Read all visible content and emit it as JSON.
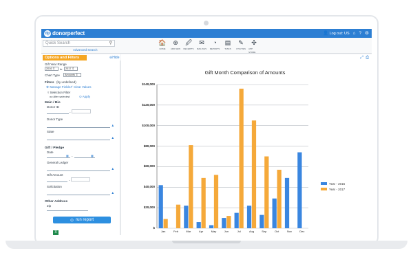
{
  "app": {
    "brand": "donorperfect",
    "logout_label": "Log out: US"
  },
  "search": {
    "placeholder": "Quick Search",
    "advanced_label": "Advanced Search"
  },
  "nav": [
    {
      "label": "HOME",
      "icon": "home-icon",
      "glyph": "🏠"
    },
    {
      "label": "ADD NEW",
      "icon": "add-icon",
      "glyph": "⊕"
    },
    {
      "label": "RECEIPTS",
      "icon": "receipt-icon",
      "glyph": "🖉"
    },
    {
      "label": "MAILINGS",
      "icon": "envelope-icon",
      "glyph": "✉"
    },
    {
      "label": "REPORTS",
      "icon": "pie-chart-icon",
      "glyph": "◔"
    },
    {
      "label": "TASKS",
      "icon": "clipboard-icon",
      "glyph": "▤"
    },
    {
      "label": "UTILITIES",
      "icon": "wrench-icon",
      "glyph": "✎"
    },
    {
      "label": "APP STORE",
      "icon": "puzzle-icon",
      "glyph": "✣"
    }
  ],
  "sidebar": {
    "title": "Options and Filters",
    "hide_label": "Hide",
    "gift_year_range_label": "Gift Year Range",
    "year_from": "2016",
    "to_label": "to",
    "year_to": "2017",
    "chart_type_label": "Chart Type",
    "chart_type_value": "Amounts",
    "filters_label": "Filters",
    "filters_value": "(by undefined)",
    "manage_fields": "Manage Fields",
    "clear_values": "Clear Values",
    "selection_filter_label": "Selection Filter",
    "selection_filter_value": "no filter selected",
    "apply_label": "Apply",
    "main_bio": "Main / Bio",
    "donor_id": "Donor ID",
    "donor_type": "Donor Type",
    "state": "State",
    "gift_pledge": "Gift / Pledge",
    "date": "Date",
    "general_ledger": "General Ledger",
    "gift_amount": "Gift Amount",
    "solicitation": "Solicitation",
    "other_address": "Other Address",
    "zip": "Zip",
    "run_report": "run report",
    "dash": "-"
  },
  "chart_data": {
    "type": "bar",
    "title": "Gift Month Comparison of Amounts",
    "categories": [
      "Jan",
      "Feb",
      "Mar",
      "Apr",
      "May",
      "Jun",
      "Jul",
      "Aug",
      "Sep",
      "Oct",
      "Nov",
      "Dec"
    ],
    "ylim": [
      0,
      140000
    ],
    "y_ticks": [
      "$",
      "$20,000",
      "$40,000",
      "$60,000",
      "$80,000",
      "$100,000",
      "$120,000",
      "$140,000"
    ],
    "legend_position": "right",
    "grid": true,
    "series": [
      {
        "name": "Year - 2016",
        "color": "#3a86e0",
        "values": [
          42000,
          0,
          22000,
          6000,
          3000,
          10000,
          15000,
          22000,
          13000,
          29000,
          49000,
          74000
        ]
      },
      {
        "name": "Year - 2017",
        "color": "#f5a93a",
        "values": [
          9000,
          23000,
          81000,
          49000,
          52000,
          12000,
          136000,
          105000,
          70000,
          57000,
          0,
          0
        ]
      }
    ]
  },
  "colors": {
    "brand_blue": "#2d7fd3",
    "accent_orange": "#f5a623"
  }
}
